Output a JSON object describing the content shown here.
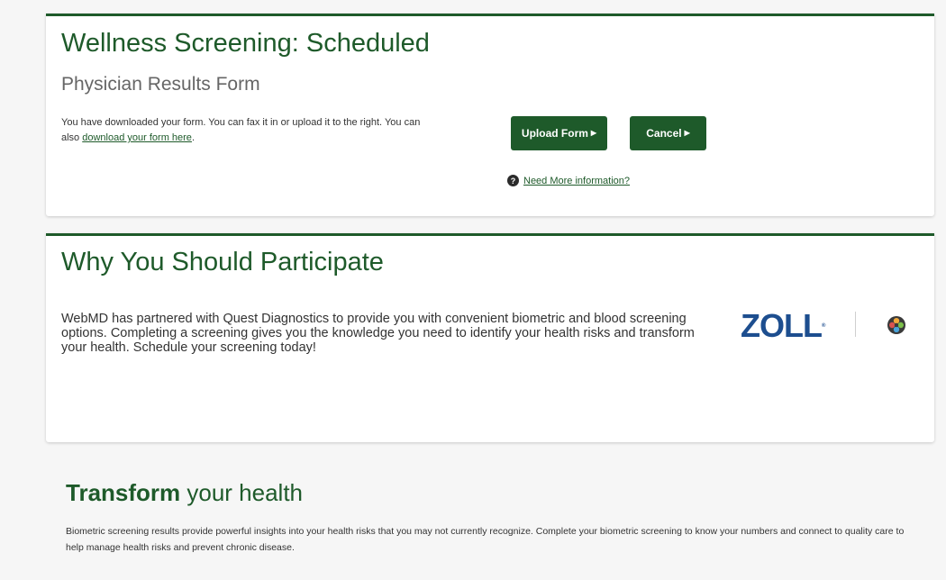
{
  "scheduled_card": {
    "title": "Wellness Screening: Scheduled",
    "subtitle": "Physician Results Form",
    "message": "You have downloaded your form. You can fax it in or upload it to the right. You can also ",
    "download_link": "download your form here",
    "message_end": ".",
    "upload_button": "Upload Form",
    "cancel_button": "Cancel",
    "help_icon_glyph": "?",
    "help_link": "Need More information?"
  },
  "participate_card": {
    "title": "Why You Should Participate",
    "body": "WebMD has partnered with Quest Diagnostics to provide you with convenient biometric and blood screening options. Completing a screening gives you the knowledge you need to identify your health risks and transform your health. Schedule your screening today!",
    "logo_text": "ZOLL",
    "logo_mark": "®",
    "partner_icon": "quest-diagnostics-logo-icon"
  },
  "promo": {
    "title_bold": "Transform",
    "title_rest": " your health",
    "text": "Biometric screening results provide powerful insights into your health risks that you may not currently recognize. Complete your biometric screening to know your numbers and connect to quality care to help manage health risks and prevent chronic disease."
  },
  "colors": {
    "brand_green": "#1e5a2a",
    "zoll_blue": "#1d4e8f",
    "background": "#f6f6f6"
  }
}
